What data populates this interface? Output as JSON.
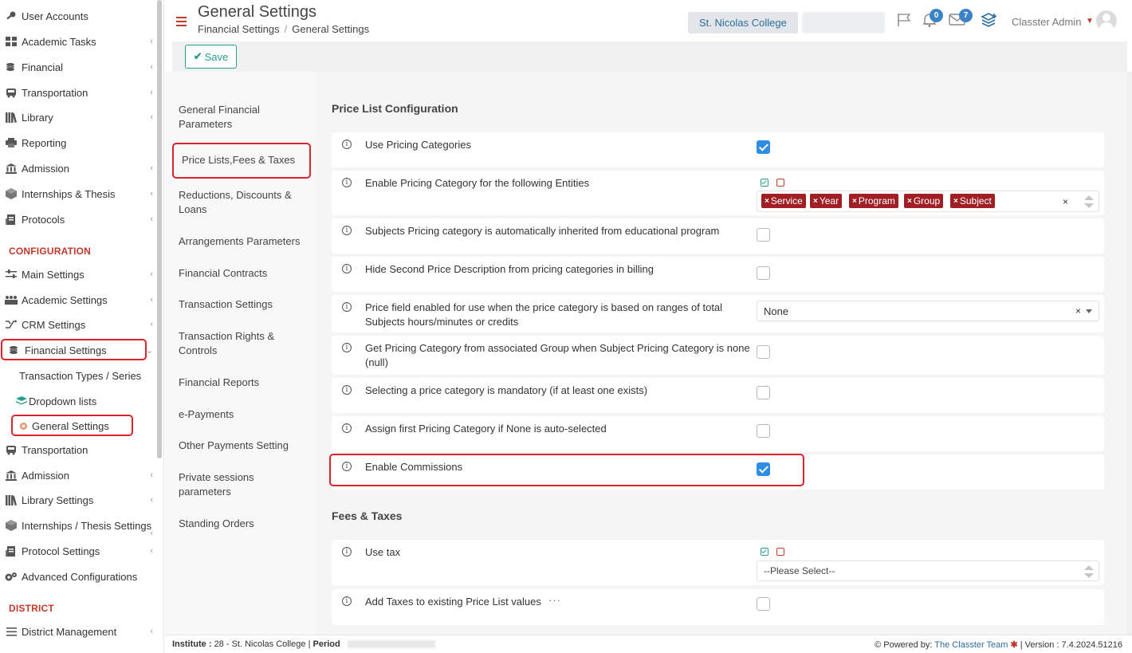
{
  "sidebar": {
    "items": [
      {
        "label": "User Accounts",
        "icon": "key-icon"
      },
      {
        "label": "Academic Tasks",
        "icon": "grid-icon"
      },
      {
        "label": "Financial",
        "icon": "coins-icon"
      },
      {
        "label": "Transportation",
        "icon": "bus-icon"
      },
      {
        "label": "Library",
        "icon": "books-icon"
      },
      {
        "label": "Reporting",
        "icon": "printer-icon"
      },
      {
        "label": "Admission",
        "icon": "institution-icon"
      },
      {
        "label": "Internships & Thesis",
        "icon": "cube-icon"
      },
      {
        "label": "Protocols",
        "icon": "protocol-icon"
      }
    ],
    "config_section": "CONFIGURATION",
    "config_items": [
      {
        "label": "Main Settings",
        "icon": "sliders-icon"
      },
      {
        "label": "Academic Settings",
        "icon": "users-icon"
      },
      {
        "label": "CRM Settings",
        "icon": "shuffle-icon"
      },
      {
        "label": "Financial Settings",
        "icon": "coins-icon"
      }
    ],
    "financial_sub": {
      "transaction_types": "Transaction Types / Series",
      "dropdown_lists": "Dropdown lists",
      "general_settings": "General Settings"
    },
    "config_items_2": [
      {
        "label": "Transportation",
        "icon": "bus-icon"
      },
      {
        "label": "Admission",
        "icon": "institution-icon"
      },
      {
        "label": "Library Settings",
        "icon": "books-icon"
      },
      {
        "label": "Internships / Thesis Settings",
        "icon": "cube-icon"
      },
      {
        "label": "Protocol Settings",
        "icon": "protocol-icon"
      },
      {
        "label": "Advanced Configurations",
        "icon": "gears-icon"
      }
    ],
    "district_section": "DISTRICT",
    "district_items": [
      {
        "label": "District Management",
        "icon": "list-icon"
      }
    ]
  },
  "header": {
    "title": "General Settings",
    "breadcrumb": [
      "Financial Settings",
      "General Settings"
    ],
    "institute": "St. Nicolas College",
    "notifications_count": "0",
    "messages_count": "7",
    "user": "Classter Admin"
  },
  "toolbar": {
    "save_label": "Save"
  },
  "subnav": [
    "General Financial Parameters",
    "Price Lists,Fees & Taxes",
    "Reductions, Discounts & Loans",
    "Arrangements Parameters",
    "Financial Contracts",
    "Transaction Settings",
    "Transaction Rights & Controls",
    "Financial Reports",
    "e-Payments",
    "Other Payments Setting",
    "Private sessions parameters",
    "Standing Orders"
  ],
  "price_list": {
    "title": "Price List Configuration",
    "rows": [
      {
        "label": "Use Pricing Categories",
        "checked": true
      },
      {
        "label": "Enable Pricing Category for the following Entities",
        "tags": [
          "Service",
          "Year",
          "Program",
          "Group",
          "Subject"
        ]
      },
      {
        "label": "Subjects Pricing category is automatically inherited from educational program",
        "checked": false
      },
      {
        "label": "Hide Second Price Description from pricing categories in billing",
        "checked": false
      },
      {
        "label": "Price field enabled for use when the price category is based on ranges of total Subjects hours/minutes or credits",
        "select": "None"
      },
      {
        "label": "Get Pricing Category from associated Group when Subject Pricing Category is none (null)",
        "checked": false
      },
      {
        "label": "Selecting a price category is mandatory (if at least one exists)",
        "checked": false
      },
      {
        "label": "Assign first Pricing Category if None is auto-selected",
        "checked": false
      },
      {
        "label": "Enable Commissions",
        "checked": true
      }
    ]
  },
  "fees_taxes": {
    "title": "Fees & Taxes",
    "rows": [
      {
        "label": "Use tax",
        "placeholder": "--Please Select--"
      },
      {
        "label": "Add Taxes to existing Price List values",
        "checked": false
      }
    ]
  },
  "footer": {
    "institute_label": "Institute :",
    "institute_value": "28 - St. Nicolas College",
    "period_label": "Period",
    "powered_by": "Powered by:",
    "team": "The Classter Team",
    "version": "| Version : 7.4.2024.51216"
  },
  "colors": {
    "accent_red": "#d9232e",
    "tag_red": "#a01f25",
    "checkbox_blue": "#2f8de4",
    "save_green": "#2a9d8f",
    "link_blue": "#2d6c9c"
  }
}
